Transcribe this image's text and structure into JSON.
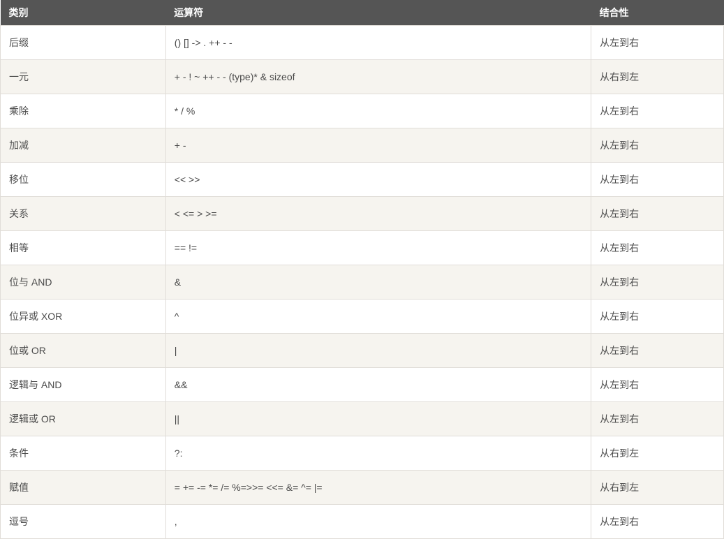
{
  "table": {
    "headers": {
      "category": "类别",
      "operator": "运算符",
      "associativity": "结合性"
    },
    "rows": [
      {
        "category": "后缀",
        "operator": "() [] -> . ++ - -",
        "associativity": "从左到右"
      },
      {
        "category": "一元",
        "operator": "+ - ! ~ ++ - - (type)* & sizeof",
        "associativity": "从右到左"
      },
      {
        "category": "乘除",
        "operator": "* / %",
        "associativity": "从左到右"
      },
      {
        "category": "加减",
        "operator": "+ -",
        "associativity": "从左到右"
      },
      {
        "category": "移位",
        "operator": "<< >>",
        "associativity": "从左到右"
      },
      {
        "category": "关系",
        "operator": "< <= > >=",
        "associativity": "从左到右"
      },
      {
        "category": "相等",
        "operator": "== !=",
        "associativity": "从左到右"
      },
      {
        "category": "位与 AND",
        "operator": "&",
        "associativity": "从左到右"
      },
      {
        "category": "位异或 XOR",
        "operator": "^",
        "associativity": "从左到右"
      },
      {
        "category": "位或 OR",
        "operator": "|",
        "associativity": "从左到右"
      },
      {
        "category": "逻辑与 AND",
        "operator": "&&",
        "associativity": "从左到右"
      },
      {
        "category": "逻辑或 OR",
        "operator": "||",
        "associativity": "从左到右"
      },
      {
        "category": "条件",
        "operator": "?:",
        "associativity": "从右到左"
      },
      {
        "category": "赋值",
        "operator": "= += -= *= /= %=>>= <<= &= ^= |=",
        "associativity": "从右到左"
      },
      {
        "category": "逗号",
        "operator": ",",
        "associativity": "从左到右"
      }
    ]
  }
}
